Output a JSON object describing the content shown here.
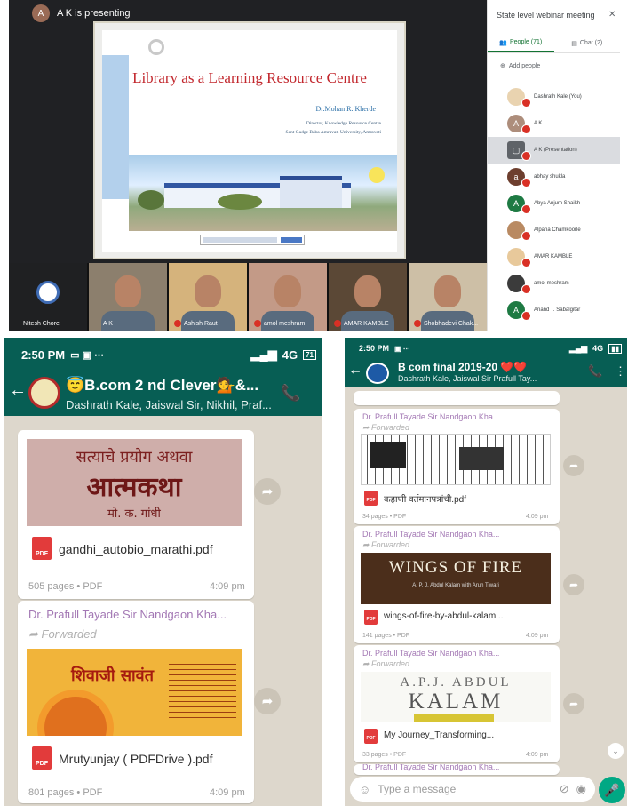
{
  "meet": {
    "presenting": "A K is presenting",
    "presenter_initial": "A",
    "meeting_title": "State level webinar meeting",
    "tabs": [
      {
        "label": "People (71)"
      },
      {
        "label": "Chat (2)"
      }
    ],
    "add_people": "Add people",
    "participants": [
      {
        "initial": "",
        "name": "Dashrath Kale (You)"
      },
      {
        "initial": "A",
        "name": "A K"
      },
      {
        "initial": "",
        "name": "A K (Presentation)"
      },
      {
        "initial": "a",
        "name": "abhay shukla"
      },
      {
        "initial": "A",
        "name": "Abya Anjum Shaikh"
      },
      {
        "initial": "",
        "name": "Alpana Chamkoorle"
      },
      {
        "initial": "",
        "name": "AMAR KAMBLE"
      },
      {
        "initial": "",
        "name": "amol meshram"
      },
      {
        "initial": "A",
        "name": "Anand T. Sabalgitar"
      }
    ],
    "slide": {
      "title": "Library as a Learning Resource Centre",
      "author": "Dr.Mohan R. Kherde",
      "line1": "Director, Knowledge Resource Centre",
      "line2": "Sant Gadge Baba Amravati University, Amravati"
    },
    "tiles": [
      {
        "name": "Nitesh Chore"
      },
      {
        "name": "A K"
      },
      {
        "name": "Ashish Raut"
      },
      {
        "name": "amol meshram"
      },
      {
        "name": "AMAR KAMBLE"
      },
      {
        "name": "Shobhadevi Chak..."
      }
    ]
  },
  "wa_left": {
    "time": "2:50 PM",
    "signal": "4G",
    "battery": "71",
    "group_name": "😇B.com 2 nd Clever💁&...",
    "members": "Dashrath Kale, Jaiswal Sir, Nikhil, Praf...",
    "messages": [
      {
        "cover": {
          "l1": "सत्याचे प्रयोग अथवा",
          "l2": "आत्मकथा",
          "l3": "मो. क. गांधी"
        },
        "file": "gandhi_autobio_marathi.pdf",
        "meta": "505 pages • PDF",
        "time": "4:09 pm"
      },
      {
        "sender": "Dr. Prafull Tayade Sir Nandgaon Kha...",
        "forwarded": "Forwarded",
        "cover": {
          "title": "शिवाजी सावंत"
        },
        "file": "Mrutyunjay ( PDFDrive ).pdf",
        "meta": "801 pages • PDF",
        "time": "4:09 pm"
      }
    ]
  },
  "wa_right": {
    "time": "2:50 PM",
    "signal": "4G",
    "group_name": "B com final 2019-20 ❤️❤️",
    "members": "Dashrath Kale, Jaiswal Sir Prafull Tay...",
    "messages": [
      {
        "sender": "Dr. Prafull Tayade Sir Nandgaon Kha...",
        "forwarded": "Forwarded",
        "file": "कहाणी वर्तमानपत्रांची.pdf",
        "meta": "34 pages • PDF",
        "time": "4:09 pm"
      },
      {
        "sender": "Dr. Prafull Tayade Sir Nandgaon Kha...",
        "forwarded": "Forwarded",
        "cover": {
          "title": "WINGS OF FIRE",
          "sub": "A. P. J. Abdul Kalam with Arun Tiwari"
        },
        "file": "wings-of-fire-by-abdul-kalam...",
        "meta": "141 pages • PDF",
        "time": "4:09 pm"
      },
      {
        "sender": "Dr. Prafull Tayade Sir Nandgaon Kha...",
        "forwarded": "Forwarded",
        "cover": {
          "l1": "A.P.J. ABDUL",
          "l2": "KALAM"
        },
        "file": "My Journey_Transforming...",
        "meta": "33 pages • PDF",
        "time": "4:09 pm"
      },
      {
        "sender": "Dr. Prafull Tayade Sir Nandgaon Kha..."
      }
    ],
    "input_placeholder": "Type a message"
  }
}
